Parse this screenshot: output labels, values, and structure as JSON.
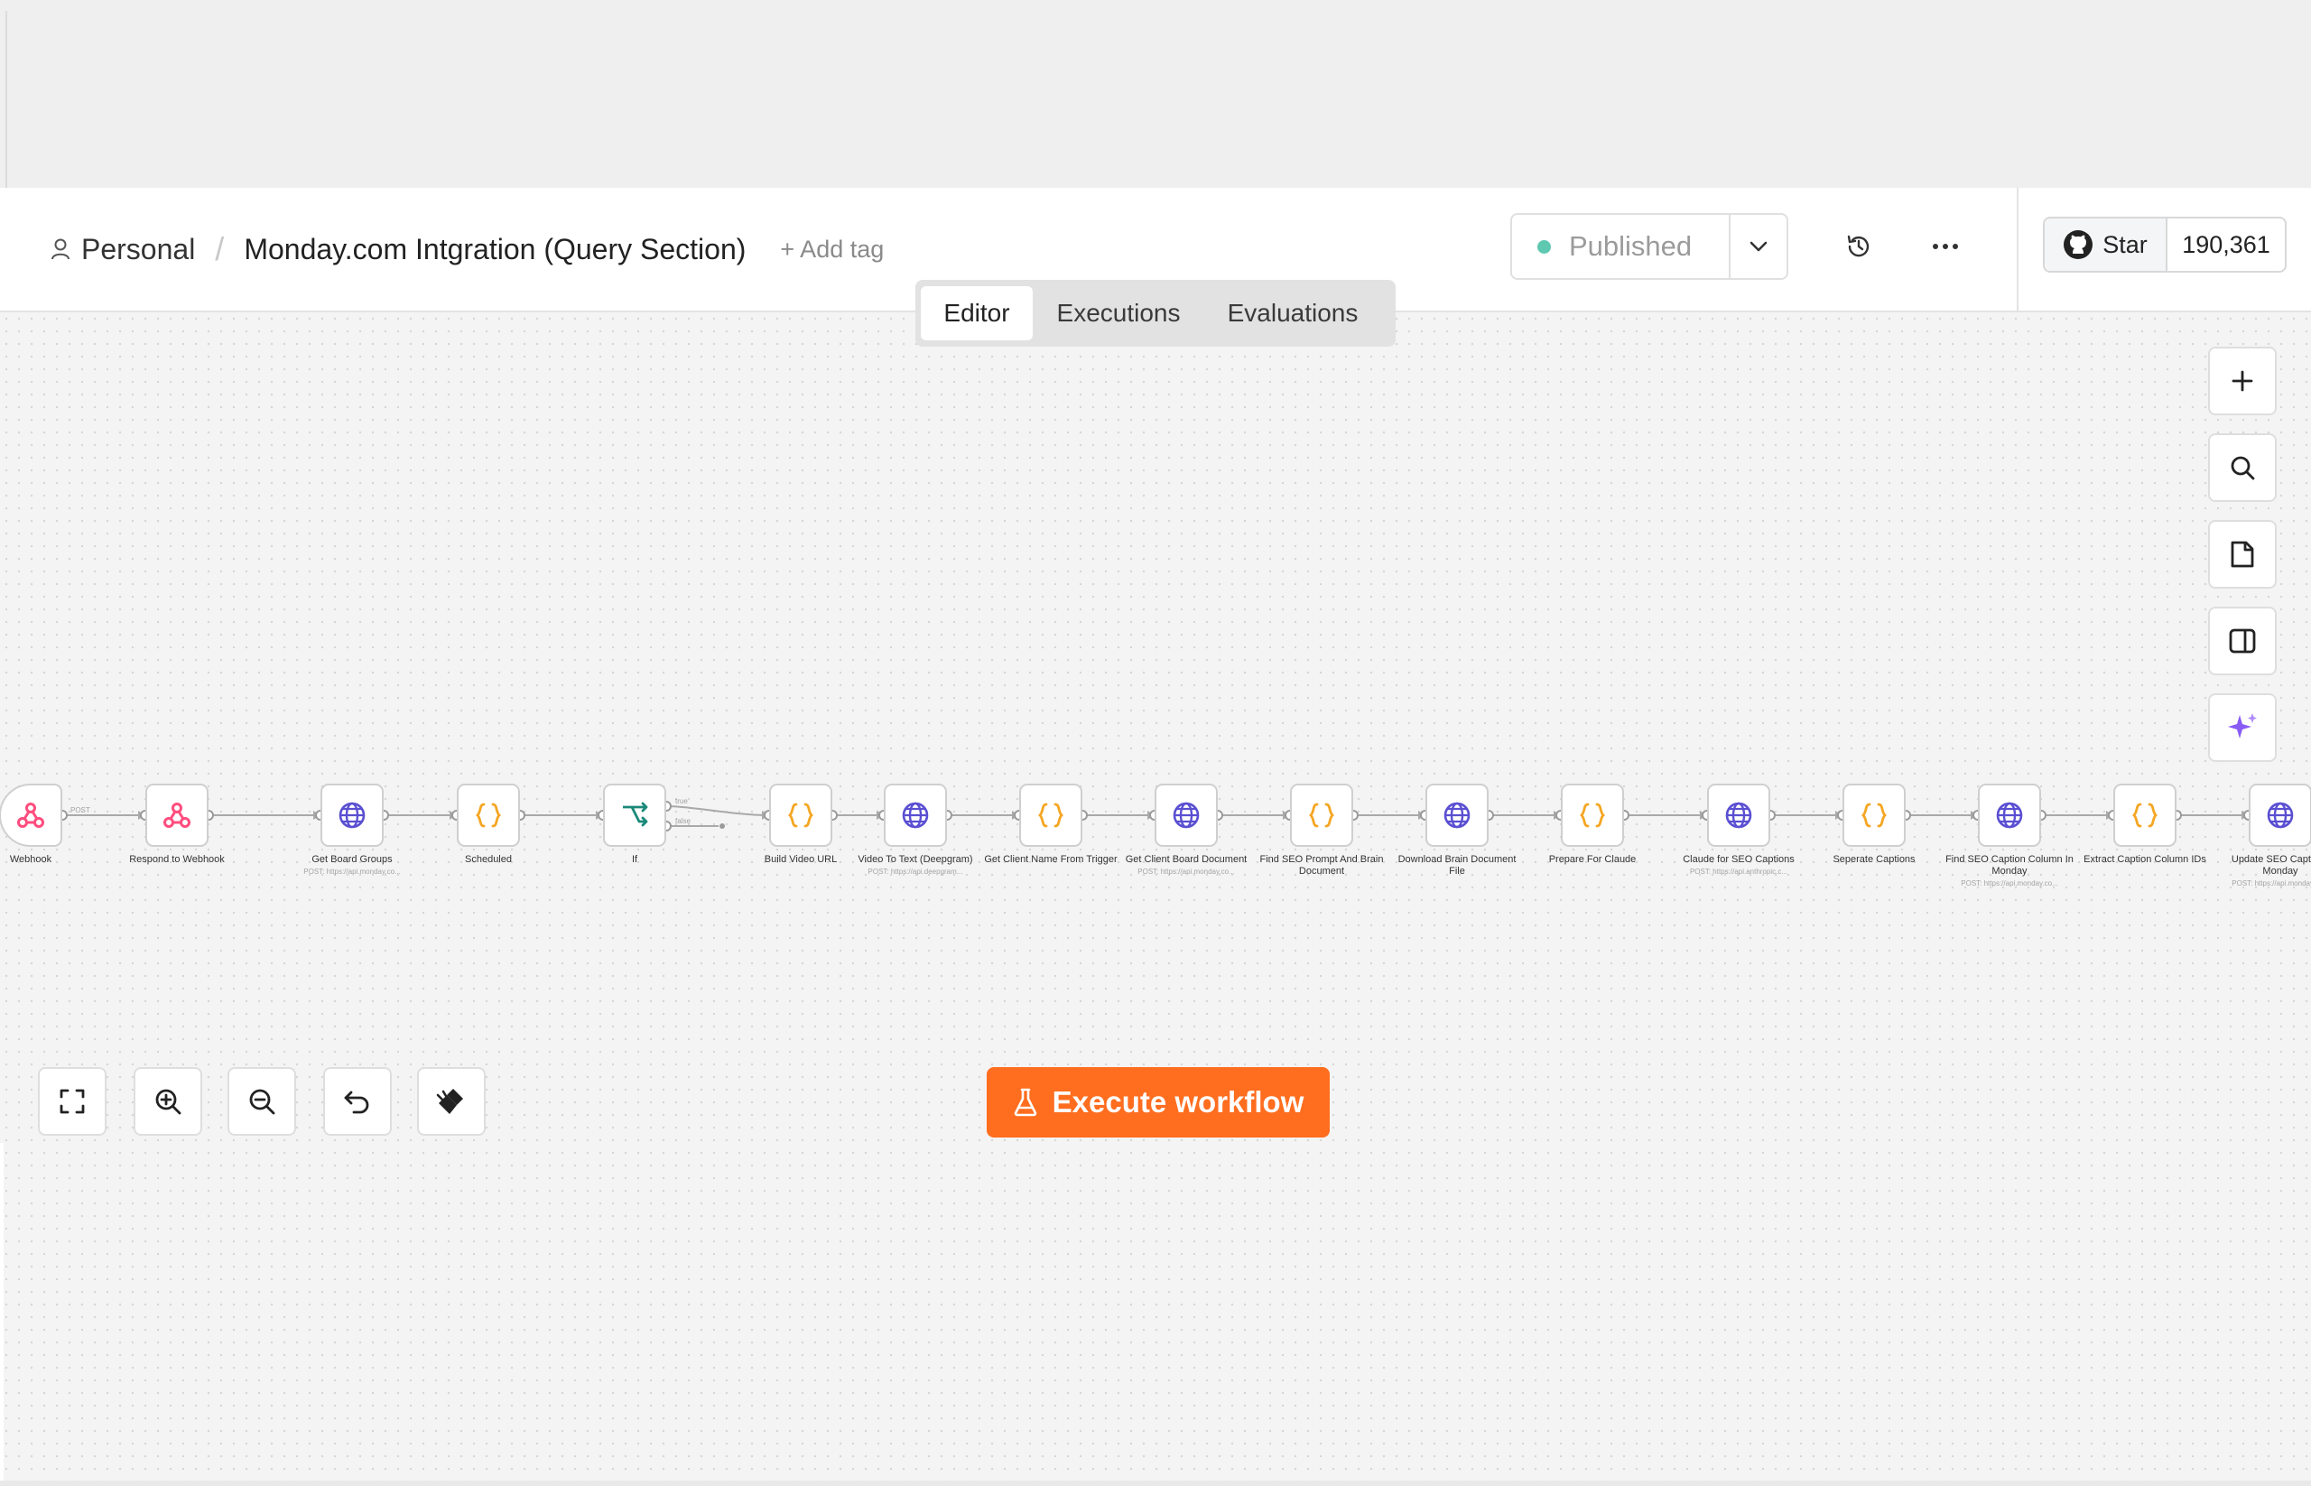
{
  "breadcrumb": {
    "user_icon": "user-icon",
    "project": "Personal",
    "separator": "/",
    "workflow_title": "Monday.com Intgration (Query Section)",
    "add_tag": "+ Add tag"
  },
  "publish": {
    "status": "Published",
    "status_color": "#5ec8b0",
    "caret_icon": "chevron-down-icon"
  },
  "header_icons": {
    "history": "history-icon",
    "more": "more-horizontal-icon"
  },
  "github": {
    "star_label": "Star",
    "star_count": "190,361",
    "icon": "github-icon"
  },
  "tabs": [
    {
      "label": "Editor",
      "active": true
    },
    {
      "label": "Executions",
      "active": false
    },
    {
      "label": "Evaluations",
      "active": false
    }
  ],
  "nodes": [
    {
      "label": "Webhook",
      "subtitle": "",
      "icon": "webhook-icon"
    },
    {
      "label": "Respond to Webhook",
      "subtitle": "",
      "icon": "webhook-icon"
    },
    {
      "label": "Get Board Groups",
      "subtitle": "POST: https://api.monday.co...",
      "icon": "globe-icon"
    },
    {
      "label": "Scheduled",
      "subtitle": "",
      "icon": "code-braces-icon"
    },
    {
      "label": "If",
      "subtitle": "",
      "icon": "branch-icon"
    },
    {
      "label": "Build Video URL",
      "subtitle": "",
      "icon": "code-braces-icon"
    },
    {
      "label": "Video To Text (Deepgram)",
      "subtitle": "POST: https://api.deepgram...",
      "icon": "globe-icon"
    },
    {
      "label": "Get Client Name From Trigger",
      "subtitle": "",
      "icon": "code-braces-icon"
    },
    {
      "label": "Get Client Board Document",
      "subtitle": "POST: https://api.monday.co...",
      "icon": "globe-icon"
    },
    {
      "label": "Find SEO Prompt And Brain Document",
      "subtitle": "",
      "icon": "code-braces-icon"
    },
    {
      "label": "Download Brain Document File",
      "subtitle": "",
      "icon": "globe-icon"
    },
    {
      "label": "Prepare For Claude",
      "subtitle": "",
      "icon": "code-braces-icon"
    },
    {
      "label": "Claude for SEO Captions",
      "subtitle": "POST: https://api.anthropic.c...",
      "icon": "globe-icon"
    },
    {
      "label": "Seperate Captions",
      "subtitle": "",
      "icon": "code-braces-icon"
    },
    {
      "label": "Find SEO Caption Column In Monday",
      "subtitle": "POST: https://api.monday.co...",
      "icon": "globe-icon"
    },
    {
      "label": "Extract Caption Column IDs",
      "subtitle": "",
      "icon": "code-braces-icon"
    },
    {
      "label": "Update SEO Captions Monday",
      "subtitle": "POST: https://api.monday.co...",
      "icon": "globe-icon"
    }
  ],
  "edge_labels": {
    "webhook_out": "POST",
    "if_true": "true",
    "if_false": "false"
  },
  "canvas_right_tools": [
    "plus-icon",
    "search-icon",
    "sticky-note-icon",
    "panel-icon",
    "sparkle-ai-icon"
  ],
  "canvas_bottom_tools": [
    "fit-view-icon",
    "zoom-in-icon",
    "zoom-out-icon",
    "undo-icon",
    "clear-execution-icon"
  ],
  "execute_button": {
    "label": "Execute workflow",
    "icon": "flask-icon",
    "color": "#ff6d1f"
  },
  "colors": {
    "webhook": "#ff4d7d",
    "http": "#5a4fd1",
    "code": "#f5a623",
    "if": "#1b8a7a"
  }
}
